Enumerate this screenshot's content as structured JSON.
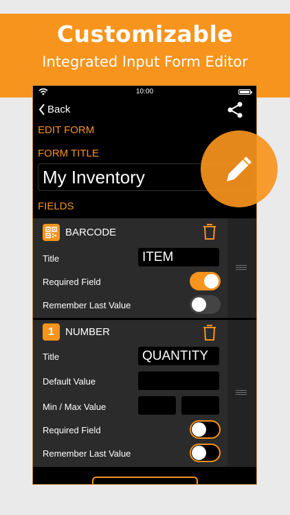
{
  "banner": {
    "headline": "Customizable",
    "subhead": "Integrated Input Form Editor",
    "color": "#f7941d"
  },
  "status_bar": {
    "time": "10:00"
  },
  "nav": {
    "back_label": "Back"
  },
  "form": {
    "section_label": "EDIT FORM",
    "title_label": "FORM TITLE",
    "title_value": "My Inventory",
    "fields_label": "FIELDS"
  },
  "fields": [
    {
      "type": "BARCODE",
      "icon": "qr-code-icon",
      "title_label": "Title",
      "title_value": "ITEM",
      "required_label": "Required Field",
      "required": true,
      "remember_label": "Remember Last Value",
      "remember": false
    },
    {
      "type": "NUMBER",
      "icon_text": "1",
      "title_label": "Title",
      "title_value": "QUANTITY",
      "default_label": "Default Value",
      "default_value": "",
      "minmax_label": "Min / Max Value",
      "min_value": "",
      "max_value": "",
      "required_label": "Required Field",
      "required": false,
      "remember_label": "Remember Last Value",
      "remember": false
    }
  ]
}
